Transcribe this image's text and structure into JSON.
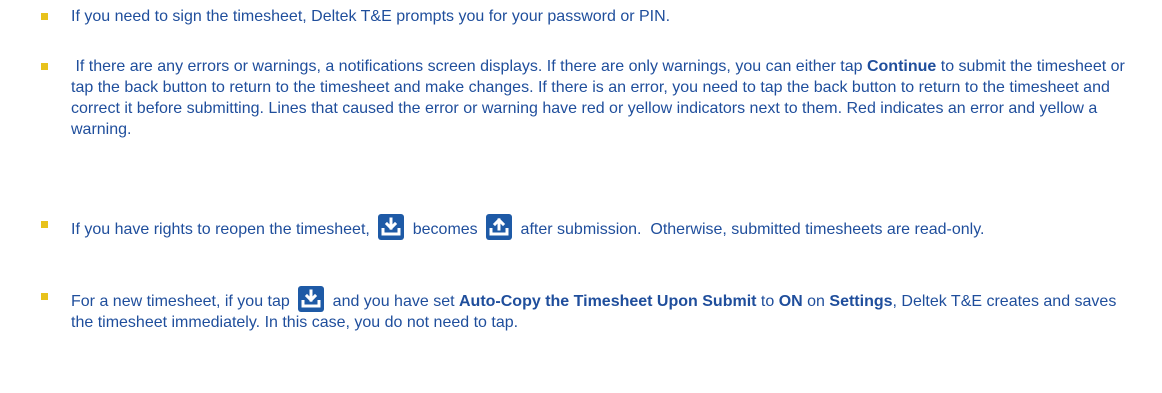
{
  "items": [
    {
      "text": "If you need to sign the timesheet, Deltek T&E prompts you for your password or PIN."
    },
    {
      "p1": " If there are any errors or warnings, a notifications screen displays. If there are only warnings, you can either tap ",
      "b1": "Continue",
      "p2": " to submit the timesheet or tap the back button to return to the timesheet and make changes. If there is an error, you need to tap the back button to return to the timesheet and correct it before submitting. Lines that caused the error or warning have red or yellow indicators next to them. Red indicates an error and yellow a warning."
    },
    {
      "p1": "If you have rights to reopen the timesheet, ",
      "p2": " becomes ",
      "p3": " after submission.  Otherwise, submitted timesheets are read-only."
    },
    {
      "p1": "For a new timesheet, if you tap ",
      "p2": " and you have set ",
      "b1": "Auto-Copy the Timesheet Upon Submit",
      "p3": " to ",
      "b2": "ON",
      "p4": " on ",
      "b3": "Settings",
      "p5": ", Deltek T&E creates and saves the timesheet immediately. In this case, you do not need to tap."
    }
  ],
  "icons": {
    "submit": "submit-download-icon",
    "reopen": "reopen-upload-icon"
  },
  "colors": {
    "text": "#1f4e9c",
    "bullet": "#e8c21b",
    "icon_bg": "#1e5aa6"
  }
}
